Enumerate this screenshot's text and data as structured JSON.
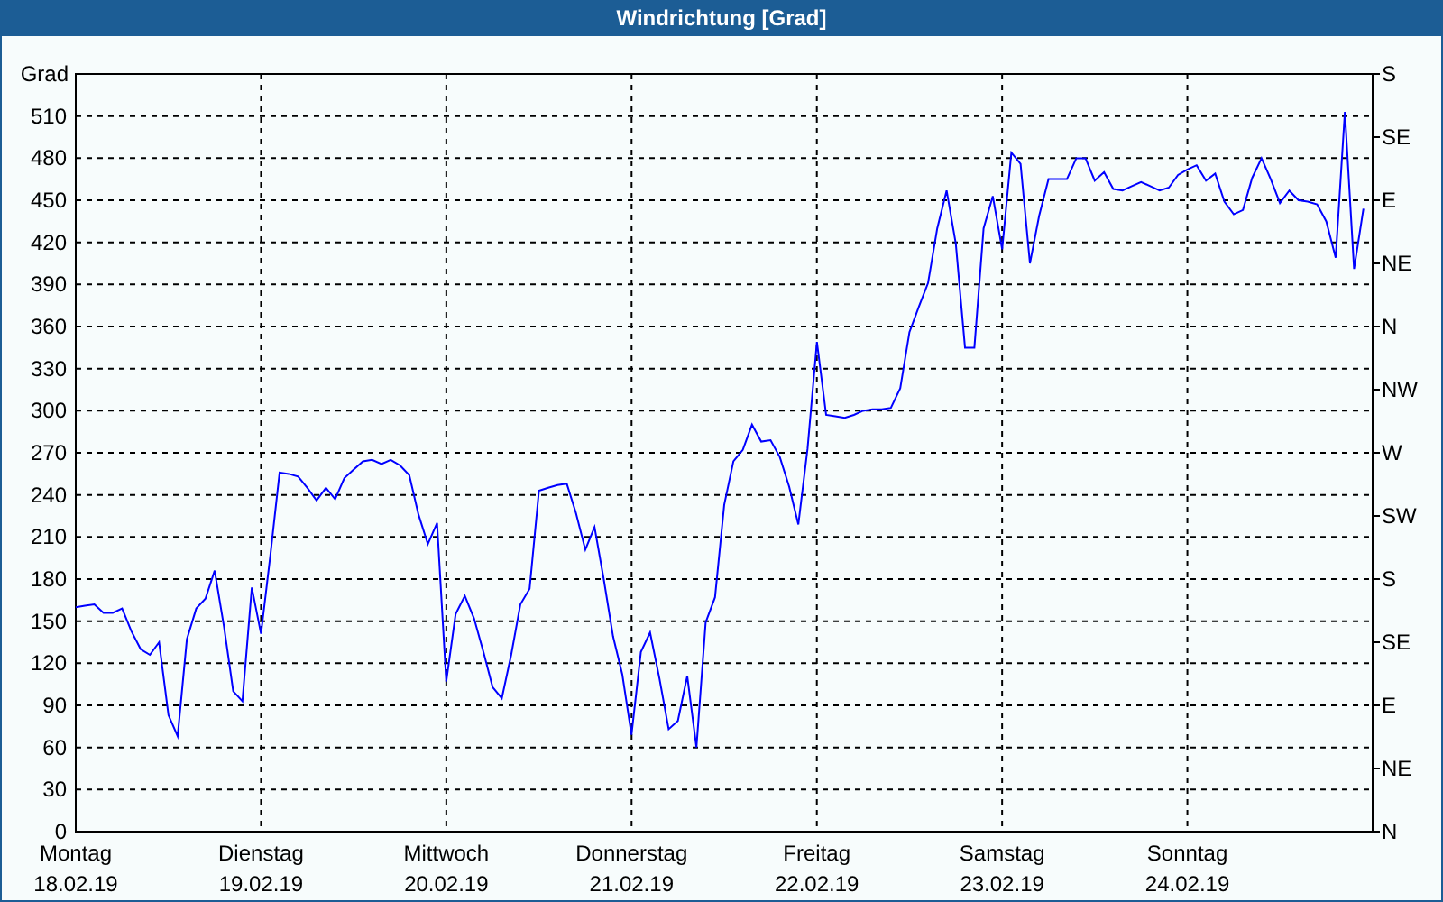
{
  "window": {
    "title": "Windrichtung [Grad]"
  },
  "chart": {
    "chart_data": {
      "type": "line",
      "grid": true,
      "ylabel": "Grad",
      "ylim": [
        0,
        540
      ],
      "yticks": [
        0,
        30,
        60,
        90,
        120,
        150,
        180,
        210,
        240,
        270,
        300,
        330,
        360,
        390,
        420,
        450,
        480,
        510
      ],
      "categories": [
        "Montag",
        null,
        null,
        null,
        null,
        null,
        null,
        null,
        null,
        null,
        null,
        null,
        null,
        null,
        null,
        null,
        null,
        null,
        null,
        null,
        "Dienstag",
        null,
        null,
        null,
        null,
        null,
        null,
        null,
        null,
        null,
        null,
        null,
        null,
        null,
        null,
        null,
        null,
        null,
        null,
        null,
        "Mittwoch",
        null,
        null,
        null,
        null,
        null,
        null,
        null,
        null,
        null,
        null,
        null,
        null,
        null,
        null,
        null,
        null,
        null,
        null,
        null,
        "Donnerstag",
        null,
        null,
        null,
        null,
        null,
        null,
        null,
        null,
        null,
        null,
        null,
        null,
        null,
        null,
        null,
        null,
        null,
        null,
        null,
        "Freitag",
        null,
        null,
        null,
        null,
        null,
        null,
        null,
        null,
        null,
        null,
        null,
        null,
        null,
        null,
        null,
        null,
        null,
        null,
        null,
        "Samstag",
        null,
        null,
        null,
        null,
        null,
        null,
        null,
        null,
        null,
        null,
        null,
        null,
        null,
        null,
        null,
        null,
        null,
        null,
        null,
        "Sonntag",
        null,
        null,
        null,
        null,
        null,
        null,
        null,
        null,
        null,
        null,
        null,
        null,
        null,
        null,
        null,
        null,
        null,
        null,
        null
      ],
      "series": [
        {
          "color": "#0000ff",
          "values": [
            160,
            161,
            162,
            156,
            156,
            159,
            143,
            130,
            126,
            135,
            83,
            68,
            137,
            159,
            166,
            186,
            146,
            100,
            93,
            174,
            141,
            196,
            256,
            255,
            253,
            245,
            236,
            245,
            237,
            252,
            258,
            264,
            265,
            262,
            265,
            261,
            254,
            226,
            205,
            220,
            107,
            155,
            168,
            152,
            128,
            103,
            95,
            126,
            162,
            173,
            243,
            245,
            247,
            248,
            227,
            201,
            217,
            180,
            139,
            112,
            69,
            128,
            142,
            109,
            73,
            79,
            111,
            60,
            149,
            167,
            233,
            264,
            272,
            290,
            278,
            279,
            267,
            246,
            219,
            273,
            349,
            297,
            296,
            295,
            297,
            300,
            301,
            301,
            302,
            316,
            356,
            374,
            391,
            430,
            457,
            419,
            345,
            345,
            430,
            453,
            415,
            484,
            476,
            405,
            439,
            465,
            465,
            465,
            480,
            480,
            464,
            470,
            458,
            457,
            460,
            463,
            460,
            457,
            459,
            468,
            472,
            475,
            464,
            469,
            449,
            440,
            443,
            466,
            480,
            465,
            448,
            457,
            450,
            449,
            447,
            435,
            409,
            513,
            401,
            444
          ]
        }
      ]
    },
    "date_labels": [
      "18.02.19",
      "19.02.19",
      "20.02.19",
      "21.02.19",
      "22.02.19",
      "23.02.19",
      "24.02.19"
    ],
    "compass_labels": [
      "S",
      "SE",
      "E",
      "NE",
      "N",
      "NW",
      "W",
      "SW",
      "S",
      "SE",
      "E",
      "NE",
      "N"
    ]
  }
}
